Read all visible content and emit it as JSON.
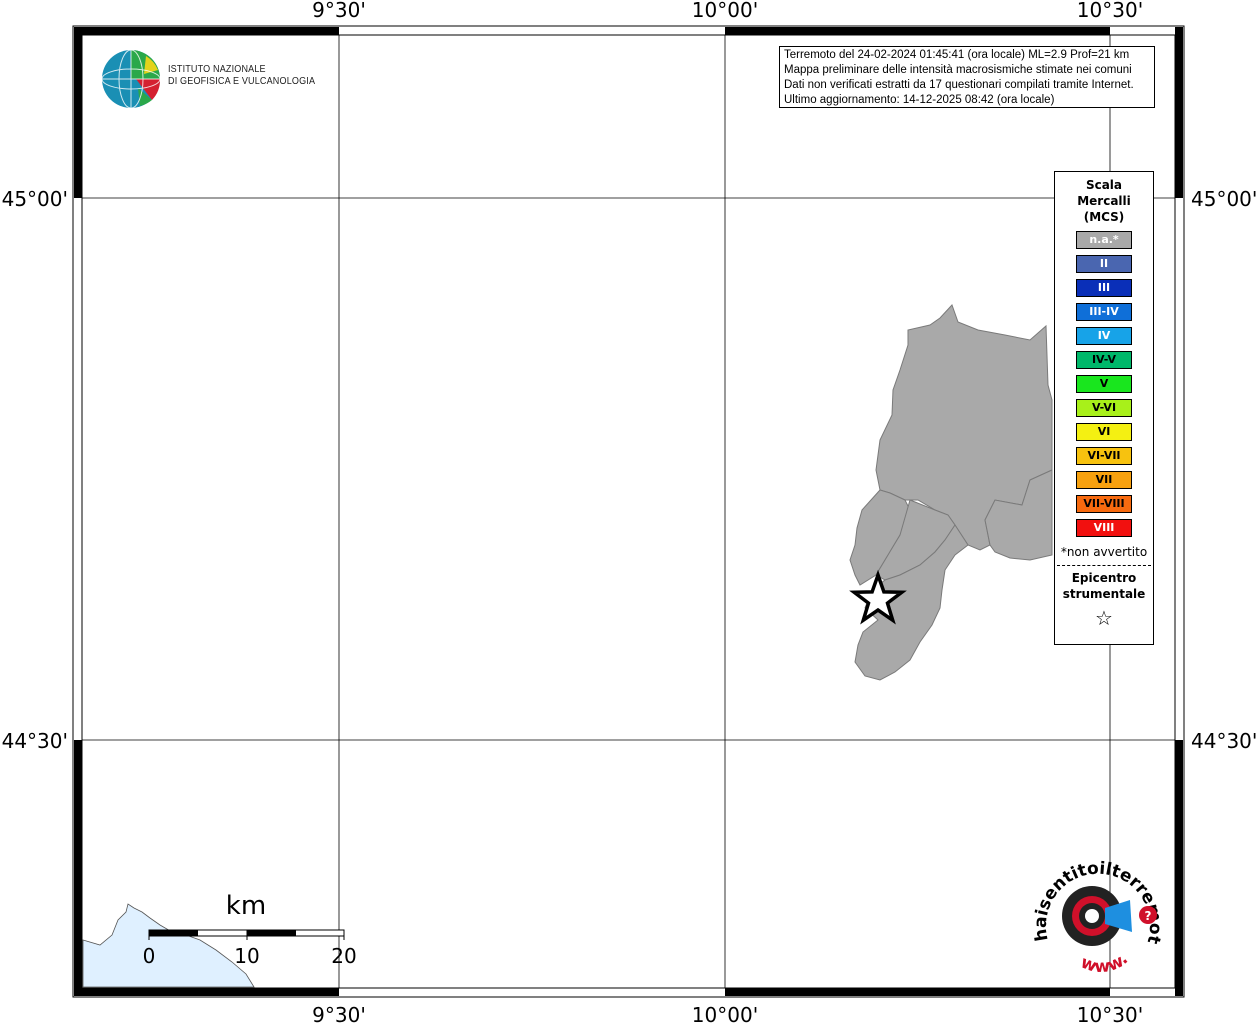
{
  "map": {
    "lon_labels": [
      "9°30'",
      "10°00'",
      "10°30'"
    ],
    "lat_labels": [
      "45°00'",
      "44°30'"
    ]
  },
  "info": {
    "line1": "Terremoto del 24-02-2024 01:45:41 (ora locale) ML=2.9 Prof=21 km",
    "line2": "Mappa preliminare delle intensità macrosismiche stimate nei comuni",
    "line3": "Dati non verificati estratti da 17 questionari compilati tramite Internet.",
    "line4": "Ultimo aggiornamento: 14-12-2025 08:42 (ora locale)"
  },
  "logo": {
    "line1": "ISTITUTO NAZIONALE",
    "line2": "DI GEOFISICA E VULCANOLOGIA"
  },
  "legend": {
    "title1": "Scala",
    "title2": "Mercalli",
    "title3": "(MCS)",
    "items": [
      {
        "label": "n.a.*",
        "color": "#a9a9a9",
        "text_color": "#ffffff"
      },
      {
        "label": "II",
        "color": "#4a66b0",
        "text_color": "#ffffff"
      },
      {
        "label": "III",
        "color": "#0a2fb8",
        "text_color": "#ffffff"
      },
      {
        "label": "III-IV",
        "color": "#0f6fd8",
        "text_color": "#ffffff"
      },
      {
        "label": "IV",
        "color": "#17a3e8",
        "text_color": "#ffffff"
      },
      {
        "label": "IV-V",
        "color": "#00b86a",
        "text_color": "#000000"
      },
      {
        "label": "V",
        "color": "#19e61e",
        "text_color": "#000000"
      },
      {
        "label": "V-VI",
        "color": "#a8f01a",
        "text_color": "#000000"
      },
      {
        "label": "VI",
        "color": "#f4f012",
        "text_color": "#000000"
      },
      {
        "label": "VI-VII",
        "color": "#f7c20f",
        "text_color": "#000000"
      },
      {
        "label": "VII",
        "color": "#f7a10f",
        "text_color": "#000000"
      },
      {
        "label": "VII-VIII",
        "color": "#f76a0f",
        "text_color": "#000000"
      },
      {
        "label": "VIII",
        "color": "#f2100f",
        "text_color": "#ffffff"
      }
    ],
    "note": "*non avvertito",
    "epicentro1": "Epicentro",
    "epicentro2": "strumentale",
    "star": "☆"
  },
  "scalebar": {
    "unit": "km",
    "ticks": [
      "0",
      "10",
      "20"
    ]
  },
  "haisentito": {
    "text": "haisentitoilterremoto.it",
    "www": "www."
  },
  "colors": {
    "municipality_fill": "#a9a9a9",
    "sea_fill": "#dff0ff"
  }
}
